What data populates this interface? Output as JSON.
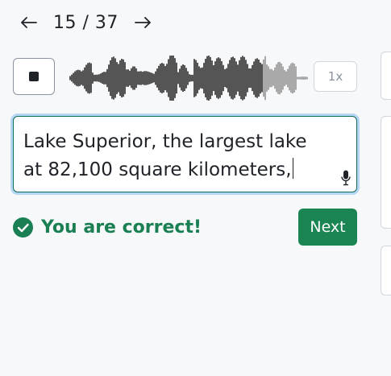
{
  "nav": {
    "counter": "15 / 37",
    "prev_icon": "arrow-left-icon",
    "next_icon": "arrow-right-icon"
  },
  "player": {
    "stop_icon": "stop-icon",
    "speed_label": "1x",
    "progress": 0.81
  },
  "answer": {
    "value": "Lake Superior, the largest lake at 82,100 square kilometers,",
    "mic_icon": "microphone-icon"
  },
  "result": {
    "message": "You are correct!",
    "icon": "check-circle-icon"
  },
  "actions": {
    "next_label": "Next"
  },
  "colors": {
    "success": "#1a7f52",
    "button": "#1a8552",
    "focus_ring": "#b6d6f6",
    "waveform_played": "#555555",
    "waveform_unplayed": "#a9a9a9"
  }
}
